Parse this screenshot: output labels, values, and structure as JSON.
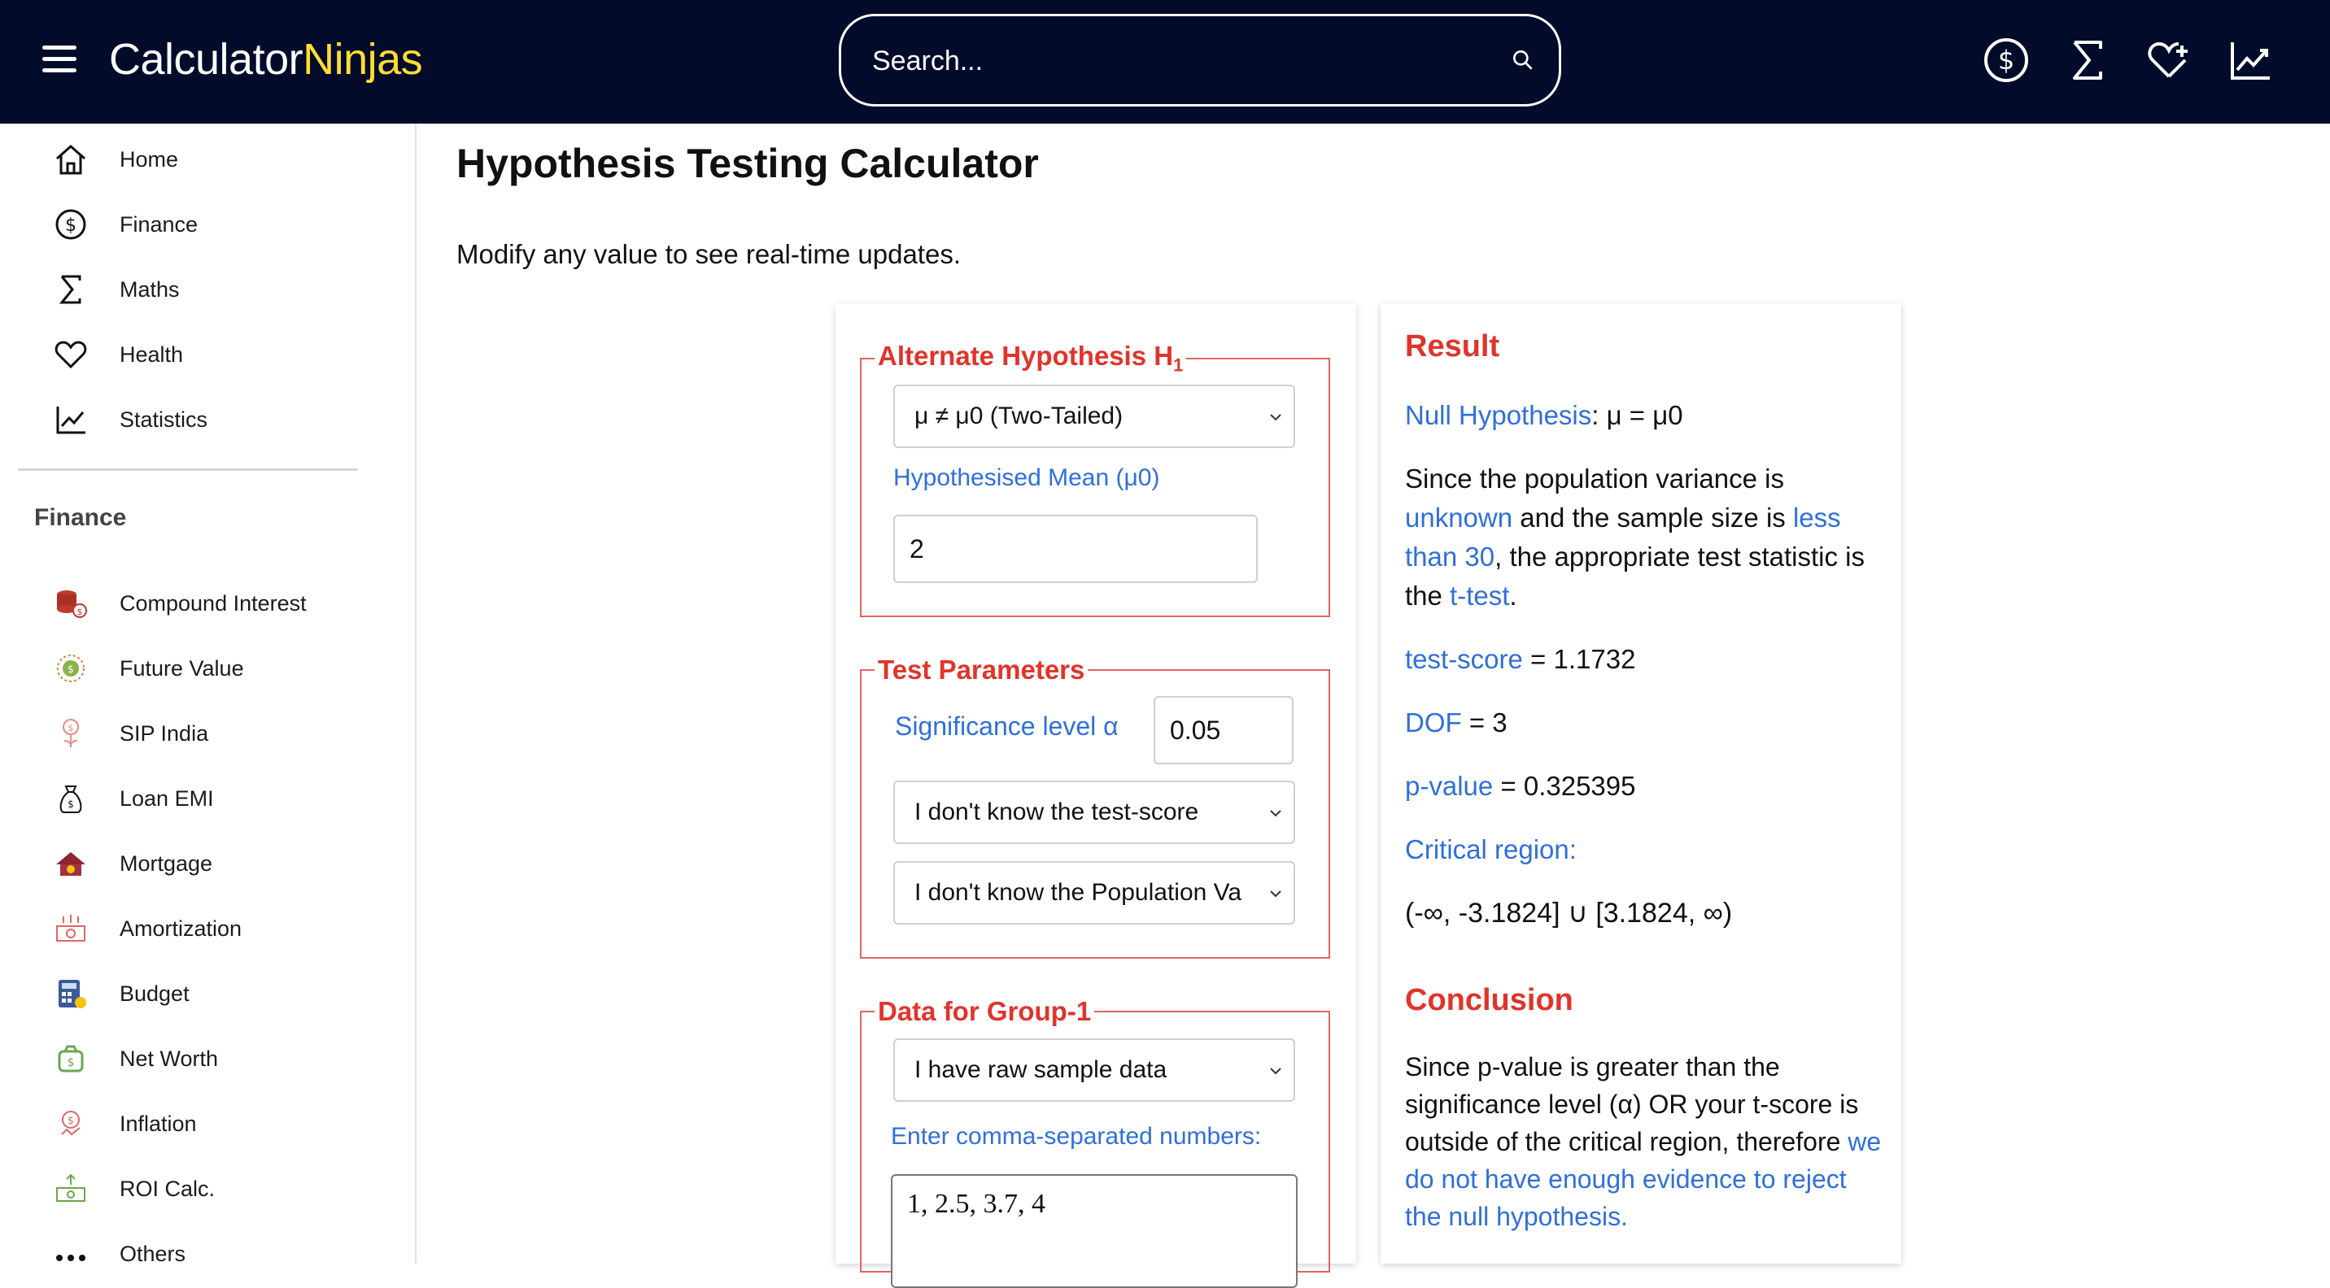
{
  "header": {
    "logo_part1": "Calculator",
    "logo_part2": "Ninjas",
    "search_placeholder": "Search..."
  },
  "sidebar": {
    "main_items": [
      {
        "label": "Home",
        "icon": "home-icon"
      },
      {
        "label": "Finance",
        "icon": "dollar-circle-icon"
      },
      {
        "label": "Maths",
        "icon": "sigma-icon"
      },
      {
        "label": "Health",
        "icon": "heart-icon"
      },
      {
        "label": "Statistics",
        "icon": "chart-icon"
      }
    ],
    "section_title": "Finance",
    "finance_items": [
      {
        "label": "Compound Interest",
        "icon": "coins-icon"
      },
      {
        "label": "Future Value",
        "icon": "future-value-icon"
      },
      {
        "label": "SIP India",
        "icon": "sip-icon"
      },
      {
        "label": "Loan EMI",
        "icon": "loan-bag-icon"
      },
      {
        "label": "Mortgage",
        "icon": "mortgage-house-icon"
      },
      {
        "label": "Amortization",
        "icon": "amortization-icon"
      },
      {
        "label": "Budget",
        "icon": "budget-calculator-icon"
      },
      {
        "label": "Net Worth",
        "icon": "net-worth-icon"
      },
      {
        "label": "Inflation",
        "icon": "inflation-icon"
      },
      {
        "label": "ROI Calc.",
        "icon": "roi-icon"
      },
      {
        "label": "Others",
        "icon": "more-dots-icon"
      }
    ]
  },
  "main": {
    "title": "Hypothesis Testing Calculator",
    "subtitle": "Modify any value to see real-time updates."
  },
  "form": {
    "alt_hypothesis": {
      "legend": "Alternate Hypothesis H",
      "legend_sub": "1",
      "selected": "μ ≠ μ0 (Two-Tailed)",
      "mean_label": "Hypothesised Mean (μ0)",
      "mean_value": "2"
    },
    "test_params": {
      "legend": "Test Parameters",
      "sig_label": "Significance level α",
      "sig_value": "0.05",
      "score_selected": "I don't know the test-score",
      "variance_selected": "I don't know the Population Va"
    },
    "group1": {
      "legend": "Data for Group-1",
      "data_selected": "I have raw sample data",
      "numbers_label": "Enter comma-separated numbers:",
      "numbers_value": "1, 2.5, 3.7, 4"
    }
  },
  "result": {
    "heading": "Result",
    "null_link": "Null Hypothesis",
    "null_value": ": μ = μ0",
    "explain_1": "Since the population variance is ",
    "explain_unknown": "unknown",
    "explain_2": " and the sample size is ",
    "explain_less": "less than 30",
    "explain_3": ", the appropriate test statistic is the ",
    "explain_ttest": "t-test",
    "explain_4": ".",
    "score_label": "test-score",
    "score_value": " = 1.1732",
    "dof_label": "DOF",
    "dof_value": " = 3",
    "p_label": "p-value",
    "p_value": " = 0.325395",
    "critical_label": "Critical region:",
    "critical_value": "(-∞, -3.1824] ∪ [3.1824, ∞)",
    "conclusion_heading": "Conclusion",
    "conclusion_1": "Since p-value is greater than the significance level (α) OR your t-score is outside of the critical region, therefore ",
    "conclusion_link": "we do not have enough evidence to reject the null hypothesis."
  },
  "colors": {
    "header_bg": "#020b2a",
    "logo_accent": "#ffdd33",
    "legend_red": "#e0342b",
    "link_blue": "#2f6fdb"
  }
}
